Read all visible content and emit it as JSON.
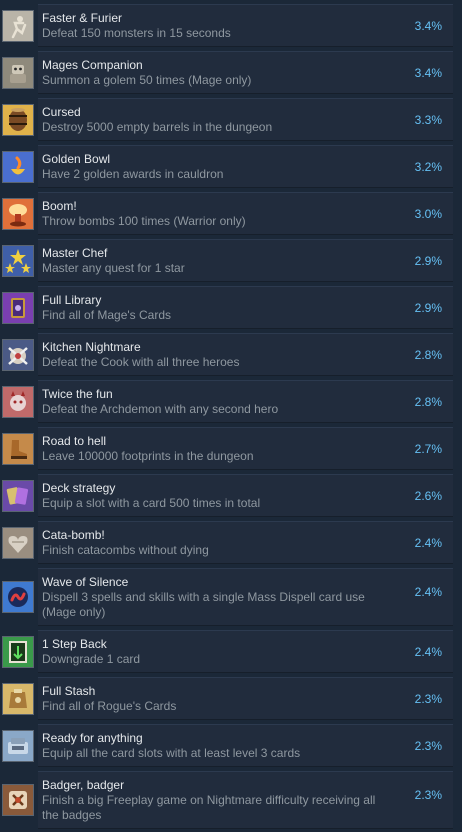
{
  "achievements": [
    {
      "title": "Faster & Furier",
      "description": "Defeat 150 monsters in 15 seconds",
      "percent": "3.4%",
      "icon": "running-figure-icon",
      "color": "#b9b4a8"
    },
    {
      "title": "Mages Companion",
      "description": "Summon a golem 50 times (Mage only)",
      "percent": "3.4%",
      "icon": "golem-icon",
      "color": "#8f8a7c"
    },
    {
      "title": "Cursed",
      "description": "Destroy 5000 empty barrels in the dungeon",
      "percent": "3.3%",
      "icon": "barrel-icon",
      "color": "#e0b24a"
    },
    {
      "title": "Golden Bowl",
      "description": "Have 2 golden awards in cauldron",
      "percent": "3.2%",
      "icon": "golden-bowl-icon",
      "color": "#4a6fd0"
    },
    {
      "title": "Boom!",
      "description": "Throw bombs 100 times (Warrior only)",
      "percent": "3.0%",
      "icon": "explosion-icon",
      "color": "#e0703a"
    },
    {
      "title": "Master Chef",
      "description": "Master any quest for 1 star",
      "percent": "2.9%",
      "icon": "stars-icon",
      "color": "#3f5fa8"
    },
    {
      "title": "Full Library",
      "description": "Find all of Mage's Cards",
      "percent": "2.9%",
      "icon": "card-library-icon",
      "color": "#7a3fb0"
    },
    {
      "title": "Kitchen Nightmare",
      "description": "Defeat the Cook with all three heroes",
      "percent": "2.8%",
      "icon": "cook-icon",
      "color": "#4b5a86"
    },
    {
      "title": "Twice the fun",
      "description": "Defeat the Archdemon with any second hero",
      "percent": "2.8%",
      "icon": "demon-icon",
      "color": "#c06a6a"
    },
    {
      "title": "Road to hell",
      "description": "Leave 100000 footprints in the dungeon",
      "percent": "2.7%",
      "icon": "boot-icon",
      "color": "#c58a4a"
    },
    {
      "title": "Deck strategy",
      "description": "Equip a slot with a card 500 times in total",
      "percent": "2.6%",
      "icon": "cards-icon",
      "color": "#6a4aa8"
    },
    {
      "title": "Cata-bomb!",
      "description": "Finish catacombs without dying",
      "percent": "2.4%",
      "icon": "heart-stone-icon",
      "color": "#9a8e80"
    },
    {
      "title": "Wave of Silence",
      "description": "Dispell 3 spells and skills with a single Mass Dispell card use (Mage only)",
      "percent": "2.4%",
      "icon": "wave-icon",
      "color": "#3f7ad0"
    },
    {
      "title": "1 Step Back",
      "description": "Downgrade 1 card",
      "percent": "2.4%",
      "icon": "step-back-icon",
      "color": "#3a9a4a"
    },
    {
      "title": "Full Stash",
      "description": "Find all of Rogue's Cards",
      "percent": "2.3%",
      "icon": "stash-icon",
      "color": "#d8b86a"
    },
    {
      "title": "Ready for anything",
      "description": "Equip all the card slots with at least level 3 cards",
      "percent": "2.3%",
      "icon": "card-slots-icon",
      "color": "#8aa8c8"
    },
    {
      "title": "Badger, badger",
      "description": "Finish a big Freeplay game on Nightmare difficulty receiving all the badges",
      "percent": "2.3%",
      "icon": "badger-icon",
      "color": "#8a5a3a"
    }
  ]
}
